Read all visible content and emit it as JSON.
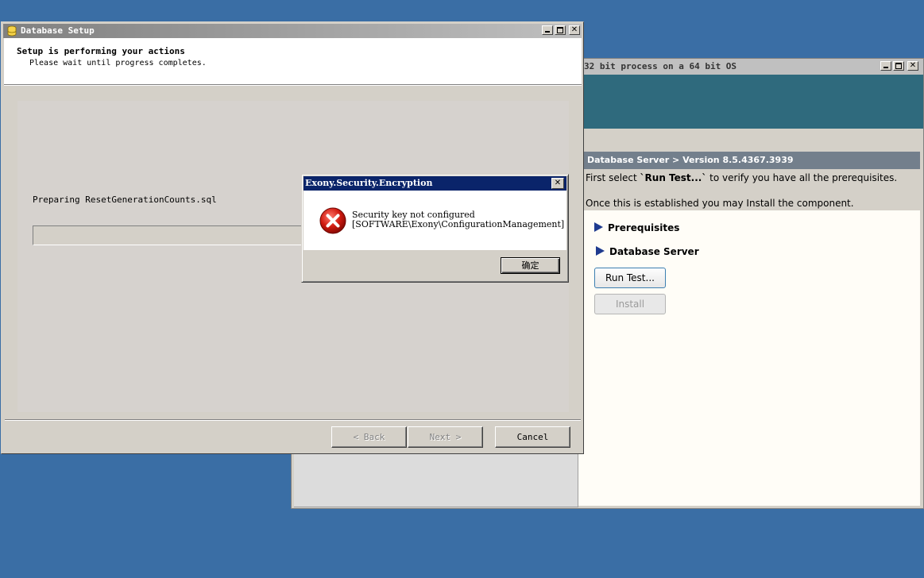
{
  "background_window": {
    "title": "32 bit process on a 64 bit OS",
    "heading": "Database Server > Version 8.5.4367.3939",
    "line1_pre": "First select ",
    "line1_bold": "`Run Test...`",
    "line1_post": " to verify you have all the prerequisites.",
    "line2": "Once this is established you may Install the component.",
    "sections": [
      "Prerequisites",
      "Database Server"
    ],
    "run_test_label": "Run Test...",
    "install_label": "Install",
    "banner_color": "#2f6a7d"
  },
  "setup_window": {
    "title": "Database Setup",
    "header_title": "Setup is performing your actions",
    "header_subtitle": "Please wait until progress completes.",
    "status_text": "Preparing ResetGenerationCounts.sql",
    "back_label": "< Back",
    "next_label": "Next >",
    "cancel_label": "Cancel"
  },
  "error_dialog": {
    "title": "Exony.Security.Encryption",
    "message_line1": "Security key not configured",
    "message_line2": "[SOFTWARE\\Exony\\ConfigurationManagement]",
    "ok_label": "确定",
    "title_color": "#0a246a"
  }
}
